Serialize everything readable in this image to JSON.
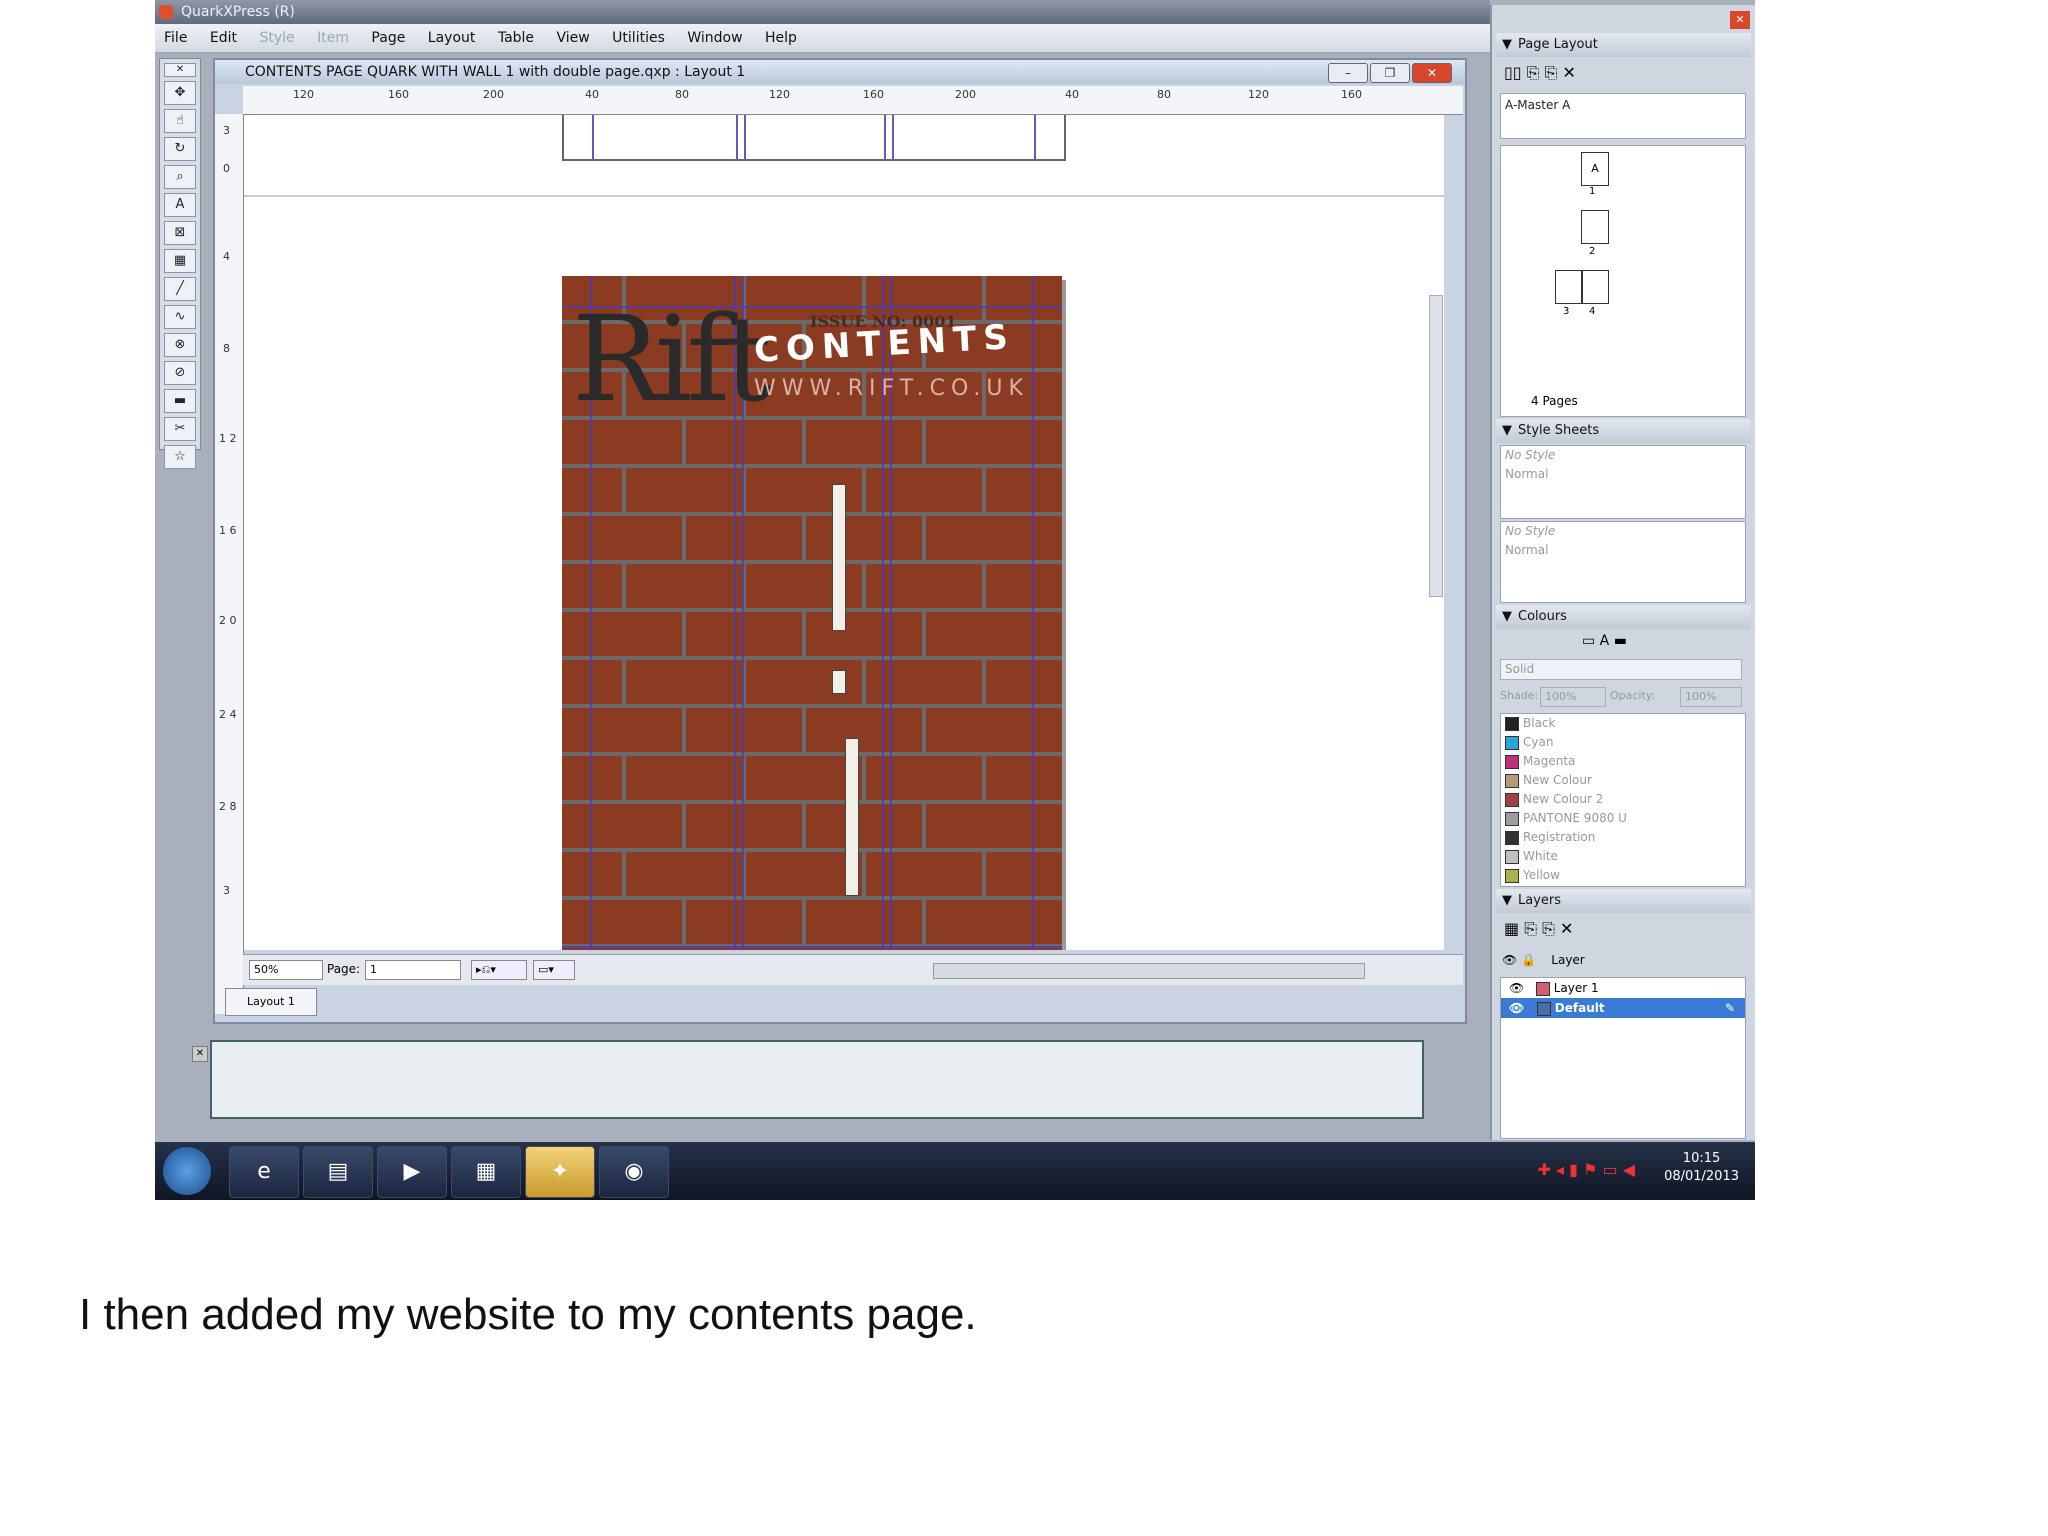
{
  "app": {
    "title": "QuarkXPress (R)"
  },
  "menu": [
    "File",
    "Edit",
    "Style",
    "Item",
    "Page",
    "Layout",
    "Table",
    "View",
    "Utilities",
    "Window",
    "Help"
  ],
  "menu_disabled": [
    "Style",
    "Item"
  ],
  "document": {
    "title": "CONTENTS PAGE QUARK WITH WALL 1 with double page.qxp : Layout 1",
    "ruler_labels": [
      "120",
      "160",
      "200",
      "40",
      "80",
      "120",
      "160",
      "200",
      "40",
      "80",
      "120",
      "160"
    ],
    "vruler_labels": [
      "3",
      "0",
      "4",
      "8",
      "1 2",
      "1 6",
      "2 0",
      "2 4",
      "2 8",
      "3"
    ],
    "zoom": "50%",
    "page_label": "Page:",
    "page_value": "1",
    "layout_tab": "Layout 1"
  },
  "page_content": {
    "logo": "Rift",
    "issue": "ISSUE NO: 0001",
    "heading": "CONTENTS",
    "website": "WWW.RIFT.CO.UK"
  },
  "palettes": {
    "page_layout": {
      "title": "Page Layout",
      "master": "A-Master A",
      "pages_count": "4 Pages",
      "page_labels": [
        "A",
        "1",
        "2",
        "3",
        "4"
      ]
    },
    "style_sheets": {
      "title": "Style Sheets",
      "paragraph": [
        "No Style",
        "Normal"
      ],
      "character": [
        "No Style",
        "Normal"
      ]
    },
    "colours": {
      "title": "Colours",
      "fill": "Solid",
      "shade_label": "Shade:",
      "shade": "100%",
      "opacity_label": "Opacity:",
      "opacity": "100%",
      "items": [
        {
          "name": "Black",
          "color": "#222222"
        },
        {
          "name": "Cyan",
          "color": "#2aa6d8"
        },
        {
          "name": "Magenta",
          "color": "#c0307a"
        },
        {
          "name": "New Colour",
          "color": "#b29a7a"
        },
        {
          "name": "New Colour 2",
          "color": "#a04040"
        },
        {
          "name": "PANTONE 9080 U",
          "color": "#9c9c9c"
        },
        {
          "name": "Registration",
          "color": "#333333"
        },
        {
          "name": "White",
          "color": "#bfbfbf"
        },
        {
          "name": "Yellow",
          "color": "#a8b44a"
        }
      ]
    },
    "layers": {
      "title": "Layers",
      "header": "Layer",
      "items": [
        {
          "name": "Layer 1",
          "color": "#d06070",
          "selected": false
        },
        {
          "name": "Default",
          "color": "#4a6aa8",
          "selected": true
        }
      ]
    }
  },
  "taskbar": {
    "time": "10:15",
    "date": "08/01/2013"
  },
  "caption": "I then added my website to my contents page."
}
